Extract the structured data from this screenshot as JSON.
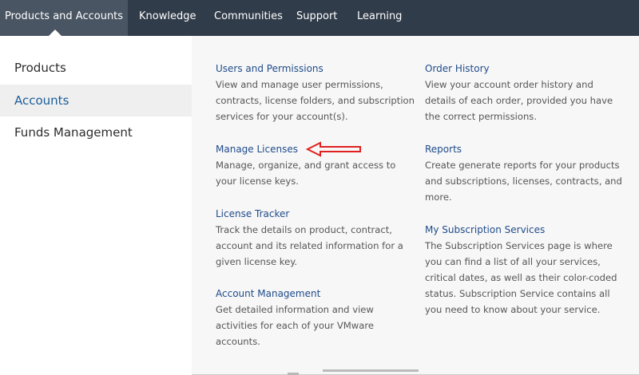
{
  "topnav": {
    "items": [
      {
        "label": "Products and Accounts",
        "active": true
      },
      {
        "label": "Knowledge"
      },
      {
        "label": "Communities"
      },
      {
        "label": "Support"
      },
      {
        "label": "Learning"
      }
    ]
  },
  "sidebar": {
    "items": [
      {
        "label": "Products"
      },
      {
        "label": "Accounts",
        "active": true
      },
      {
        "label": "Funds Management"
      }
    ]
  },
  "content": {
    "left_column": [
      {
        "title": "Users and Permissions",
        "lines": [
          "View and manage user permissions,",
          "contracts, license folders, and subscription",
          "services for your account(s)."
        ]
      },
      {
        "title": "Manage Licenses",
        "lines": [
          "Manage, organize, and grant access to",
          "your license keys."
        ]
      },
      {
        "title": "License Tracker",
        "lines": [
          "Track the details on product, contract,",
          "account and its related information for a",
          "given license key."
        ]
      },
      {
        "title": "Account Management",
        "lines": [
          "Get detailed information and view",
          "activities for each of your VMware",
          "accounts."
        ]
      }
    ],
    "right_column": [
      {
        "title": "Order History",
        "lines": [
          "View your account order history and",
          "details of each order, provided you have",
          "the correct permissions."
        ]
      },
      {
        "title": "Reports",
        "lines": [
          "Create generate reports for your products",
          "and subscriptions, licenses, contracts, and",
          "more."
        ]
      },
      {
        "title": "My Subscription Services",
        "lines": [
          "The Subscription Services page is where",
          "you can find a list of all your services,",
          "critical dates, as well as their color-coded",
          "status. Subscription Service contains all",
          "you need to know about your service."
        ]
      }
    ]
  },
  "annotation": {
    "color": "#e02020"
  }
}
